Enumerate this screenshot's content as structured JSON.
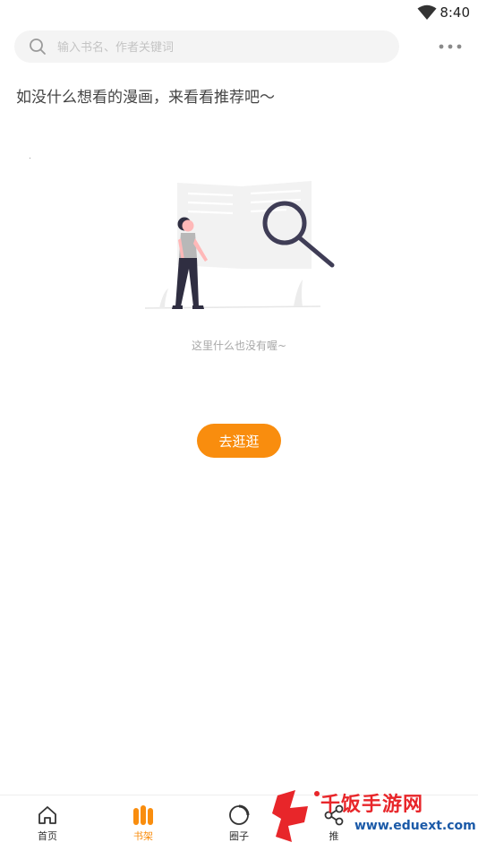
{
  "status_bar": {
    "time": "8:40",
    "wifi_icon": "wifi-icon"
  },
  "search": {
    "placeholder": "输入书名、作者关键词",
    "icon": "search-icon"
  },
  "more_icon": "more-horizontal-icon",
  "prompt_text": "如没什么想看的漫画，来看看推荐吧〜",
  "empty_state": {
    "illustration": "woman-reading-book-magnifier-illustration",
    "text": "这里什么也没有喔~",
    "button_label": "去逛逛"
  },
  "tabs": [
    {
      "label": "首页",
      "icon": "home-icon",
      "active": false
    },
    {
      "label": "书架",
      "icon": "bookshelf-icon",
      "active": true
    },
    {
      "label": "圈子",
      "icon": "circle-icon",
      "active": false
    },
    {
      "label": "推",
      "icon": "share-icon",
      "active": false
    }
  ],
  "watermark": {
    "text": "千饭手游网",
    "url": "www.eduext.com"
  },
  "colors": {
    "accent": "#f98d0e",
    "background": "#ffffff",
    "search_bg": "#f4f4f4"
  }
}
